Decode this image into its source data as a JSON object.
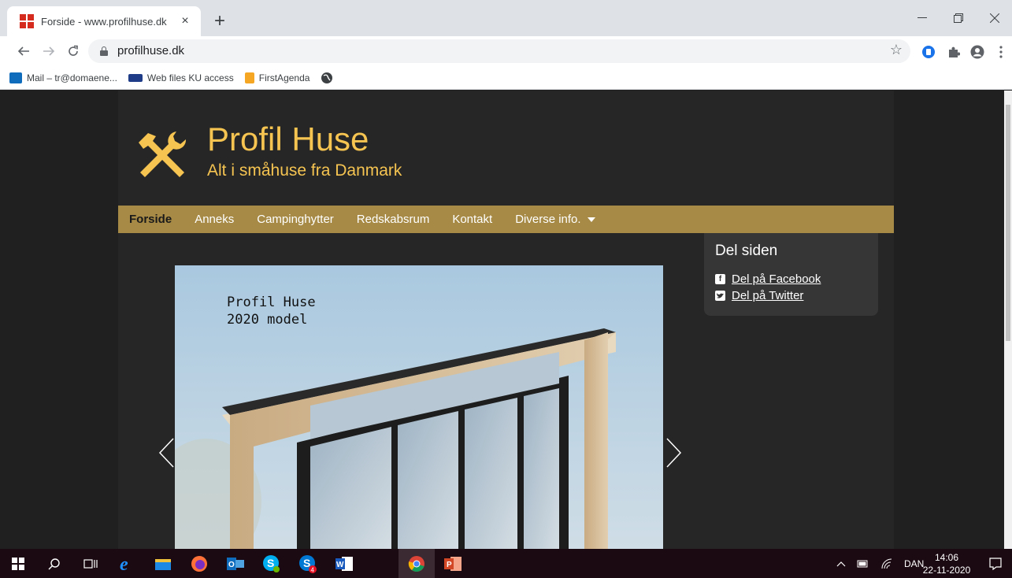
{
  "browser": {
    "tab_title": "Forside - www.profilhuse.dk",
    "tab_close": "×",
    "new_tab": "+",
    "url": "profilhuse.dk",
    "bookmarks": [
      {
        "label": "Mail – tr@domaene...",
        "icon": "outlook-icon"
      },
      {
        "label": "Web files KU access",
        "icon": "ku-icon"
      },
      {
        "label": "FirstAgenda",
        "icon": "firstagenda-icon"
      },
      {
        "label": "",
        "icon": "globe-icon"
      }
    ]
  },
  "site": {
    "title": "Profil Huse",
    "tagline": "Alt i småhuse fra Danmark",
    "accent_color": "#f5c451",
    "nav_color": "#a68a45",
    "nav": [
      {
        "label": "Forside",
        "active": true
      },
      {
        "label": "Anneks"
      },
      {
        "label": "Campinghytter"
      },
      {
        "label": "Redskabsrum"
      },
      {
        "label": "Kontakt"
      },
      {
        "label": "Diverse info.",
        "dropdown": true
      }
    ],
    "share": {
      "title": "Del siden",
      "facebook": "Del på Facebook",
      "twitter": "Del på Twitter"
    },
    "slider": {
      "caption_line1": "Profil Huse",
      "caption_line2": "2020 model"
    }
  },
  "taskbar": {
    "language": "DAN",
    "time": "14:06",
    "date": "22-11-2020",
    "apps": [
      "windows-start-icon",
      "search-icon",
      "task-view-icon",
      "internet-explorer-icon",
      "file-explorer-icon",
      "firefox-icon",
      "outlook-icon",
      "skype-icon",
      "skype-business-icon",
      "word-icon",
      "chrome-icon",
      "powerpoint-icon"
    ],
    "badge_count": "4"
  }
}
